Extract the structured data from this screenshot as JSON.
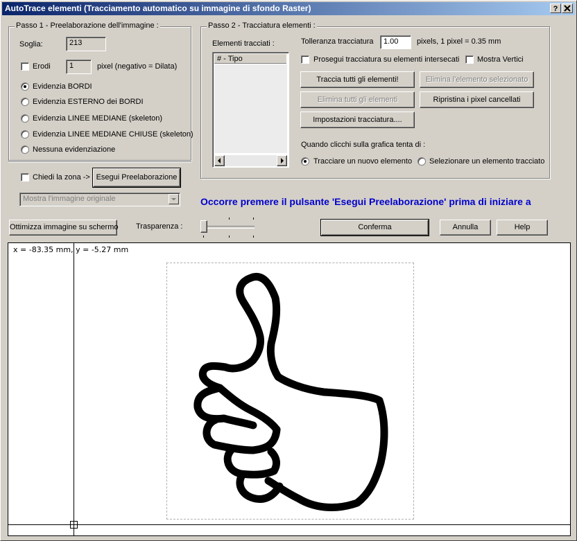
{
  "window": {
    "title": "AutoTrace elementi (Tracciamento automatico su immagine di sfondo Raster)",
    "help_btn": "?",
    "close_btn": "X"
  },
  "step1": {
    "caption": "Passo 1 - Preelaborazione dell'immagine :",
    "threshold_label": "Soglia:",
    "threshold_value": "213",
    "erode_label": "Erodi",
    "erode_value": "1",
    "erode_unit": "pixel (negativo = Dilata)",
    "radios": [
      {
        "label": "Evidenzia BORDI",
        "selected": true
      },
      {
        "label": "Evidenzia ESTERNO dei BORDI",
        "selected": false
      },
      {
        "label": "Evidenzia LINEE MEDIANE (skeleton)",
        "selected": false
      },
      {
        "label": "Evidenzia LINEE MEDIANE CHIUSE (skeleton)",
        "selected": false
      },
      {
        "label": "Nessuna evidenziazione",
        "selected": false
      }
    ],
    "zone_label": "Chiedi la zona ->",
    "preprocess_btn": "Esegui Preelaborazione",
    "view_select": "Mostra l'immagine originale"
  },
  "step2": {
    "caption": "Passo 2 - Tracciatura elementi :",
    "list_label": "Elementi tracciati :",
    "list_header": "# - Tipo",
    "tolerance_label": "Tolleranza tracciatura",
    "tolerance_value": "1.00",
    "tolerance_unit": "pixels, 1 pixel = 0.35 mm",
    "continue_label": "Prosegui tracciatura su elementi intersecati",
    "show_vertices_label": "Mostra Vertici",
    "trace_all_btn": "Traccia tutti gli elementi!",
    "delete_selected_btn": "Elimina l'elemento selezionato",
    "delete_all_btn": "Elimina tutti gli elementi",
    "restore_pixels_btn": "Ripristina i pixel cancellati",
    "settings_btn": "Impostazioni tracciatura....",
    "click_prompt": "Quando clicchi sulla grafica tenta di :",
    "click_option_new": "Tracciare un nuovo elemento",
    "click_option_select": "Selezionare un elemento tracciato"
  },
  "warning_text": "Occorre premere il pulsante 'Esegui Preelaborazione' prima di iniziare a",
  "bottom": {
    "optimize_btn": "Ottimizza immagine su schermo",
    "transparency_label": "Trasparenza :",
    "confirm_btn": "Conferma",
    "cancel_btn": "Annulla",
    "help_btn": "Help"
  },
  "canvas": {
    "coords": "x = -83.35 mm, y = -5.27 mm"
  },
  "colors": {
    "title_start": "#0a246a",
    "title_end": "#a6caf0",
    "warning": "#0000cc",
    "face": "#d4d0c8"
  }
}
